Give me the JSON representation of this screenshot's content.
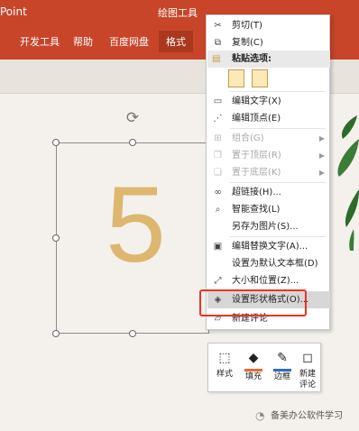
{
  "ribbon": {
    "app_title": "Point",
    "context_label": "绘图工具",
    "tabs": [
      {
        "label": "开发工具"
      },
      {
        "label": "帮助"
      },
      {
        "label": "百度网盘"
      },
      {
        "label": "格式"
      }
    ],
    "color": "#c8452a"
  },
  "canvas": {
    "text": "5"
  },
  "context_menu": {
    "cut": "剪切(T)",
    "copy": "复制(C)",
    "paste_options": "粘贴选项:",
    "edit_text": "编辑文字(X)",
    "edit_points": "编辑顶点(E)",
    "group": "组合(G)",
    "bring_to_front": "置于顶层(R)",
    "send_to_back": "置于底层(K)",
    "hyperlink": "超链接(H)...",
    "smart_lookup": "智能查找(L)",
    "save_as_picture": "另存为图片(S)...",
    "edit_alt_text": "编辑替换文字(A)...",
    "set_default_textbox": "设置为默认文本框(D)",
    "size_position": "大小和位置(Z)...",
    "format_shape": "设置形状格式(O)...",
    "new_comment": "新建评论"
  },
  "mini_toolbar": {
    "style": "样式",
    "fill": "填充",
    "outline": "边框",
    "new_comment_line1": "新建",
    "new_comment_line2": "评论",
    "fill_color": "#e86a2c",
    "outline_color": "#2e6fc2"
  },
  "highlight_color": "#ef3223",
  "watermark": "备美办公软件学习"
}
